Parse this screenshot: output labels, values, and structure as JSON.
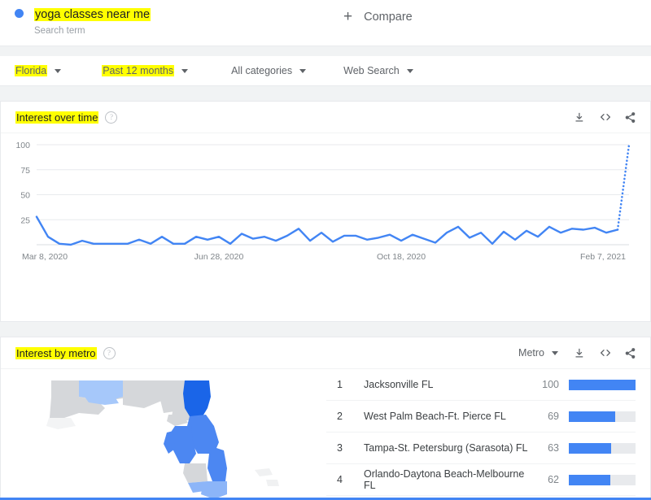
{
  "query": {
    "term": "yoga classes near me",
    "subtitle": "Search term",
    "dot_color": "#4285f4",
    "highlighted": true
  },
  "compare": {
    "label": "Compare",
    "icon": "plus-icon"
  },
  "filters": [
    {
      "name": "region",
      "label": "Florida",
      "highlighted": true
    },
    {
      "name": "time",
      "label": "Past 12 months",
      "highlighted": true
    },
    {
      "name": "category",
      "label": "All categories",
      "highlighted": false
    },
    {
      "name": "search_type",
      "label": "Web Search",
      "highlighted": false
    }
  ],
  "interest_over_time": {
    "title": "Interest over time",
    "title_highlighted": true,
    "help_icon": "help-circle-icon",
    "actions": [
      {
        "name": "download-icon",
        "label": "Download"
      },
      {
        "name": "embed-icon",
        "label": "Embed"
      },
      {
        "name": "share-icon",
        "label": "Share"
      }
    ]
  },
  "interest_by_metro": {
    "title": "Interest by metro",
    "title_highlighted": true,
    "help_icon": "help-circle-icon",
    "breakdown_label": "Metro",
    "actions": [
      {
        "name": "download-icon",
        "label": "Download"
      },
      {
        "name": "embed-icon",
        "label": "Embed"
      },
      {
        "name": "share-icon",
        "label": "Share"
      }
    ],
    "rows": [
      {
        "rank": "1",
        "name": "Jacksonville FL",
        "value": "100",
        "pct": 100
      },
      {
        "rank": "2",
        "name": "West Palm Beach-Ft. Pierce FL",
        "value": "69",
        "pct": 69
      },
      {
        "rank": "3",
        "name": "Tampa-St. Petersburg (Sarasota) FL",
        "value": "63",
        "pct": 63
      },
      {
        "rank": "4",
        "name": "Orlando-Daytona Beach-Melbourne FL",
        "value": "62",
        "pct": 62
      }
    ]
  },
  "colors": {
    "accent": "#4285f4",
    "bar_track": "#e8eaed",
    "highlight": "#ffff00",
    "text_primary": "#202124",
    "text_secondary": "#5f6368",
    "map_none": "#d5d7da"
  },
  "chart_data": {
    "type": "line",
    "title": "Interest over time",
    "xlabel": "",
    "ylabel": "",
    "ylim": [
      0,
      100
    ],
    "yticks": [
      25,
      50,
      75,
      100
    ],
    "grid": true,
    "legend": false,
    "xtick_labels": [
      "Mar 8, 2020",
      "Jun 28, 2020",
      "Oct 18, 2020",
      "Feb 7, 2021"
    ],
    "xtick_positions": [
      0,
      16,
      32,
      48
    ],
    "series": [
      {
        "name": "yoga classes near me",
        "color": "#4285f4",
        "values": [
          28,
          8,
          1,
          0,
          4,
          1,
          1,
          1,
          1,
          5,
          1,
          8,
          1,
          1,
          8,
          5,
          8,
          1,
          11,
          6,
          8,
          4,
          9,
          16,
          4,
          12,
          3,
          9,
          9,
          5,
          7,
          10,
          4,
          10,
          6,
          2,
          12,
          18,
          7,
          12,
          1,
          13,
          5,
          14,
          8,
          18,
          12,
          16,
          15,
          17,
          12,
          15,
          100
        ],
        "dashed_from_index": 51
      }
    ]
  },
  "map": {
    "name": "florida-choropleth",
    "regions_colored": true
  }
}
